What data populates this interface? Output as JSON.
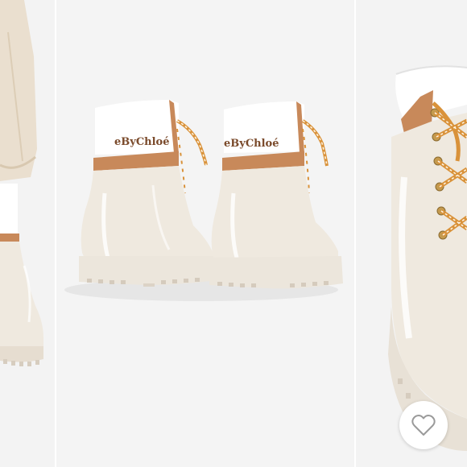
{
  "gallery": {
    "images": [
      {
        "icon": "boot-side-photo"
      },
      {
        "icon": "boots-rear-photo",
        "brand_text": "eByChloé"
      },
      {
        "icon": "boot-lace-closeup-photo"
      }
    ]
  },
  "favorite": {
    "icon": "heart-icon"
  },
  "colors": {
    "background": "#f3f3f3",
    "boot_body": "#efe9df",
    "boot_collar": "#ffffff",
    "tan_trim": "#c8895a",
    "lace_stripe": "#d9923a",
    "brand_text": "#7a4a2b",
    "heart_outline": "#9a9a9a"
  }
}
